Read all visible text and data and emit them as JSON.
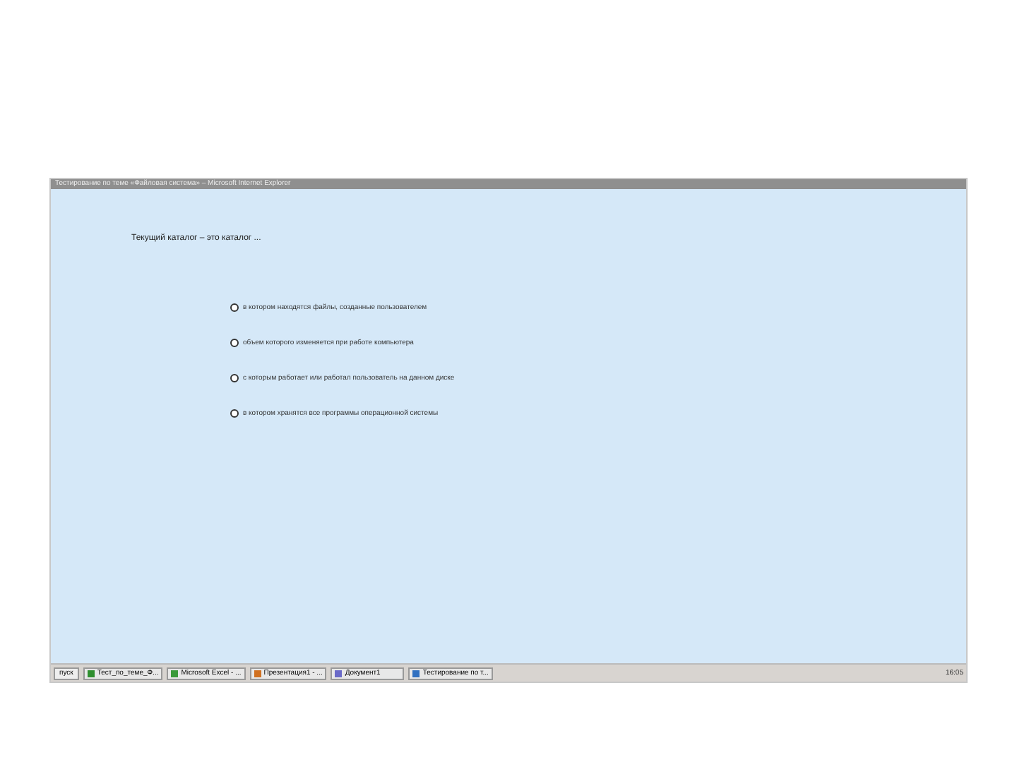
{
  "window": {
    "title": "Тестирование по теме «Файловая система» – Microsoft Internet Explorer"
  },
  "question": {
    "text": "Текущий каталог – это каталог ..."
  },
  "answers": [
    {
      "label": "в котором находятся файлы, созданные пользователем",
      "selected": false
    },
    {
      "label": "объем которого изменяется при работе компьютера",
      "selected": false
    },
    {
      "label": "с которым работает или работал пользователь на данном диске",
      "selected": false
    },
    {
      "label": "в котором хранятся все программы операционной системы",
      "selected": false
    }
  ],
  "taskbar": {
    "start": "пуск",
    "items": [
      {
        "label": "Тест_по_теме_Ф...",
        "color": "#2f8f2f"
      },
      {
        "label": "Microsoft Excel - ...",
        "color": "#3a9a3a"
      },
      {
        "label": "Презентация1 - ...",
        "color": "#d07020"
      },
      {
        "label": "Документ1",
        "color": "#6a6ac8"
      },
      {
        "label": "Тестирование по т...",
        "color": "#3070c0"
      }
    ],
    "clock": "16:05"
  }
}
